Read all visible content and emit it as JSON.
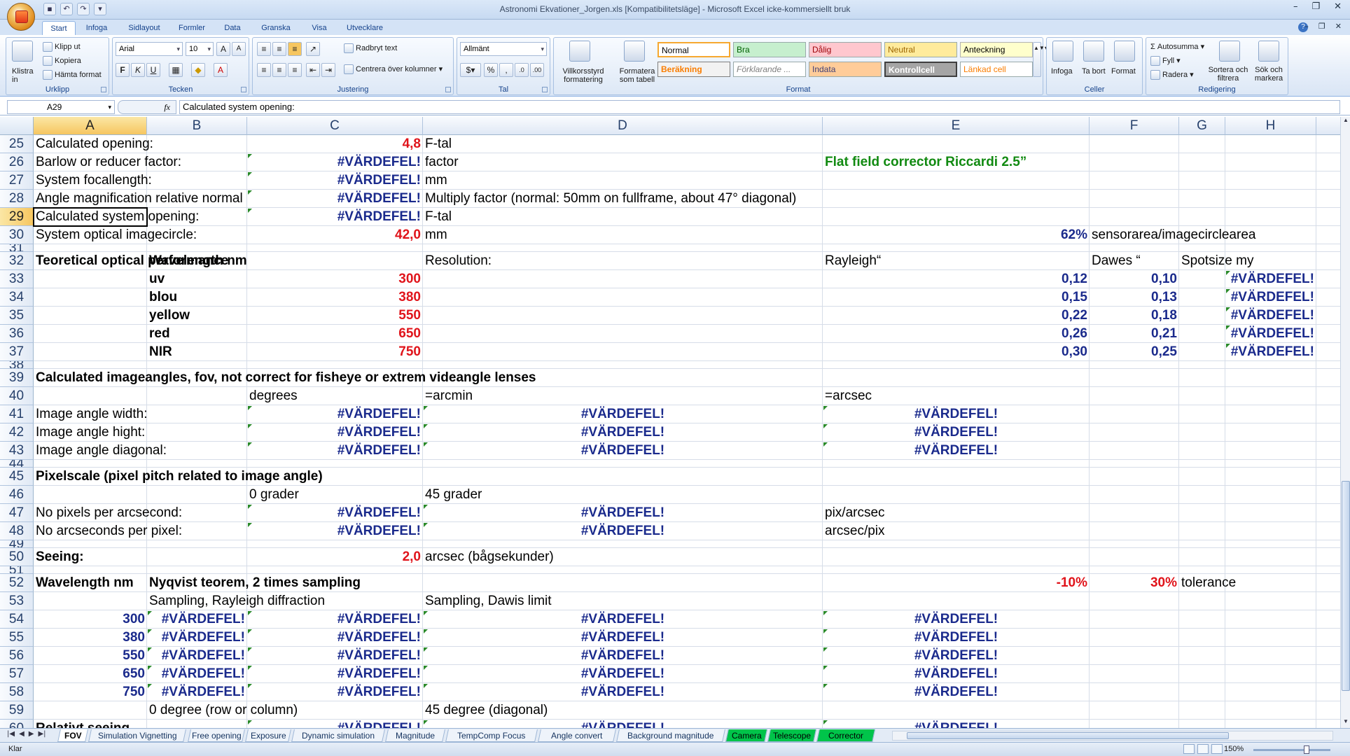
{
  "window": {
    "title": "Astronomi Ekvationer_Jorgen.xls  [Kompatibilitetsläge] - Microsoft Excel icke-kommersiellt bruk"
  },
  "ribbon_tabs": [
    "Start",
    "Infoga",
    "Sidlayout",
    "Formler",
    "Data",
    "Granska",
    "Visa",
    "Utvecklare"
  ],
  "ribbon": {
    "clipboard": {
      "paste": "Klistra\nin",
      "cut": "Klipp ut",
      "copy": "Kopiera",
      "format_painter": "Hämta format",
      "label": "Urklipp"
    },
    "font": {
      "name": "Arial",
      "size": "10",
      "label": "Tecken"
    },
    "alignment": {
      "wrap": "Radbryt text",
      "merge": "Centrera över kolumner",
      "label": "Justering"
    },
    "number": {
      "format": "Allmänt",
      "label": "Tal"
    },
    "styles": {
      "cond_format": "Villkorsstyrd formatering",
      "format_table": "Formatera som tabell",
      "cells": [
        "Normal",
        "Bra",
        "Dålig",
        "Neutral",
        "Anteckning",
        "Beräkning",
        "Förklarande ...",
        "Indata",
        "Kontrollcell",
        "Länkad cell"
      ],
      "label": "Format"
    },
    "cells_group": {
      "insert": "Infoga",
      "delete": "Ta bort",
      "format": "Format",
      "label": "Celler"
    },
    "editing": {
      "autosum": "Autosumma",
      "fill": "Fyll",
      "clear": "Radera",
      "sort": "Sortera och filtrera",
      "find": "Sök och markera",
      "label": "Redigering"
    }
  },
  "formula_bar": {
    "name_box": "A29",
    "fx": "fx",
    "content": "Calculated system opening:"
  },
  "columns": [
    "A",
    "B",
    "C",
    "D",
    "E",
    "F",
    "G",
    "H"
  ],
  "rows": [
    {
      "n": "25",
      "cells": {
        "A": "Calculated opening:",
        "C": "4,8",
        "D": "F-tal"
      }
    },
    {
      "n": "26",
      "cells": {
        "A": "Barlow or reducer factor:",
        "C": "#VÄRDEFEL!",
        "D": "factor",
        "E": "Flat field corrector Riccardi 2.5”"
      }
    },
    {
      "n": "27",
      "cells": {
        "A": "System focallength:",
        "C": "#VÄRDEFEL!",
        "D": "mm"
      }
    },
    {
      "n": "28",
      "cells": {
        "A": "Angle magnification relative normal",
        "C": "#VÄRDEFEL!",
        "D": "Multiply factor (normal: 50mm on fullframe, about 47° diagonal)"
      }
    },
    {
      "n": "29",
      "cells": {
        "A": "Calculated system opening:",
        "C": "#VÄRDEFEL!",
        "D": "F-tal"
      }
    },
    {
      "n": "30",
      "cells": {
        "A": "System optical imagecircle:",
        "C": "42,0",
        "D": "mm",
        "E": "62%",
        "F": "sensorarea/imagecirclearea"
      }
    },
    {
      "n": "31",
      "cells": {}
    },
    {
      "n": "32",
      "cells": {
        "A": "Teoretical optical performance",
        "B": "Wavelength nm",
        "D": "Resolution:",
        "E": "Rayleigh“",
        "F": "Dawes “",
        "G": "Spotsize my"
      }
    },
    {
      "n": "33",
      "cells": {
        "B": "uv",
        "C": "300",
        "E": "0,12",
        "F": "0,10",
        "H": "#VÄRDEFEL!"
      }
    },
    {
      "n": "34",
      "cells": {
        "B": "blou",
        "C": "380",
        "E": "0,15",
        "F": "0,13",
        "H": "#VÄRDEFEL!"
      }
    },
    {
      "n": "35",
      "cells": {
        "B": "yellow",
        "C": "550",
        "E": "0,22",
        "F": "0,18",
        "H": "#VÄRDEFEL!"
      }
    },
    {
      "n": "36",
      "cells": {
        "B": "red",
        "C": "650",
        "E": "0,26",
        "F": "0,21",
        "H": "#VÄRDEFEL!"
      }
    },
    {
      "n": "37",
      "cells": {
        "B": "NIR",
        "C": "750",
        "E": "0,30",
        "F": "0,25",
        "H": "#VÄRDEFEL!"
      }
    },
    {
      "n": "38",
      "cells": {}
    },
    {
      "n": "39",
      "cells": {
        "A": "Calculated imageangles, fov, not correct for fisheye or extrem videangle lenses"
      }
    },
    {
      "n": "40",
      "cells": {
        "C": "degrees",
        "D": "=arcmin",
        "E": "=arcsec"
      }
    },
    {
      "n": "41",
      "cells": {
        "A": "Image angle width:",
        "C": "#VÄRDEFEL!",
        "D": "#VÄRDEFEL!",
        "E": "#VÄRDEFEL!"
      }
    },
    {
      "n": "42",
      "cells": {
        "A": "Image angle hight:",
        "C": "#VÄRDEFEL!",
        "D": "#VÄRDEFEL!",
        "E": "#VÄRDEFEL!"
      }
    },
    {
      "n": "43",
      "cells": {
        "A": "Image angle diagonal:",
        "C": "#VÄRDEFEL!",
        "D": "#VÄRDEFEL!",
        "E": "#VÄRDEFEL!"
      }
    },
    {
      "n": "44",
      "cells": {}
    },
    {
      "n": "45",
      "cells": {
        "A": "Pixelscale (pixel pitch related to image angle)"
      }
    },
    {
      "n": "46",
      "cells": {
        "C": "0 grader",
        "D": "45 grader"
      }
    },
    {
      "n": "47",
      "cells": {
        "A": "No pixels per arcsecond:",
        "C": "#VÄRDEFEL!",
        "D": "#VÄRDEFEL!",
        "E": "pix/arcsec"
      }
    },
    {
      "n": "48",
      "cells": {
        "A": "No arcseconds per pixel:",
        "C": "#VÄRDEFEL!",
        "D": "#VÄRDEFEL!",
        "E": "arcsec/pix"
      }
    },
    {
      "n": "49",
      "cells": {}
    },
    {
      "n": "50",
      "cells": {
        "A": "Seeing:",
        "C": "2,0",
        "D": "arcsec (bågsekunder)"
      }
    },
    {
      "n": "51",
      "cells": {}
    },
    {
      "n": "52",
      "cells": {
        "A": "Wavelength nm",
        "B": "Nyqvist teorem, 2 times sampling",
        "E": "-10%",
        "F": "30%",
        "G": "tolerance"
      }
    },
    {
      "n": "53",
      "cells": {
        "B": "Sampling, Rayleigh diffraction",
        "D": "Sampling, Dawis limit"
      }
    },
    {
      "n": "54",
      "cells": {
        "A": "300",
        "B": "#VÄRDEFEL!",
        "C": "#VÄRDEFEL!",
        "D": "#VÄRDEFEL!",
        "E": "#VÄRDEFEL!"
      }
    },
    {
      "n": "55",
      "cells": {
        "A": "380",
        "B": "#VÄRDEFEL!",
        "C": "#VÄRDEFEL!",
        "D": "#VÄRDEFEL!",
        "E": "#VÄRDEFEL!"
      }
    },
    {
      "n": "56",
      "cells": {
        "A": "550",
        "B": "#VÄRDEFEL!",
        "C": "#VÄRDEFEL!",
        "D": "#VÄRDEFEL!",
        "E": "#VÄRDEFEL!"
      }
    },
    {
      "n": "57",
      "cells": {
        "A": "650",
        "B": "#VÄRDEFEL!",
        "C": "#VÄRDEFEL!",
        "D": "#VÄRDEFEL!",
        "E": "#VÄRDEFEL!"
      }
    },
    {
      "n": "58",
      "cells": {
        "A": "750",
        "B": "#VÄRDEFEL!",
        "C": "#VÄRDEFEL!",
        "D": "#VÄRDEFEL!",
        "E": "#VÄRDEFEL!"
      }
    },
    {
      "n": "59",
      "cells": {
        "B": "0 degree (row or column)",
        "D": "45 degree (diagonal)"
      }
    },
    {
      "n": "60",
      "cells": {
        "A": "Relativt seeing",
        "C": "#VÄRDEFEL!",
        "D": "#VÄRDEFEL!",
        "E": "#VÄRDEFEL!"
      }
    }
  ],
  "sheet_tabs": [
    "FOV",
    "Simulation Vignetting",
    "Free opening",
    "Exposure",
    "Dynamic simulation",
    "Magnitude",
    "TempComp Focus",
    "Angle convert",
    "Background magnitude",
    "Camera",
    "Telescope",
    "Corrector"
  ],
  "active_sheet": "FOV",
  "status": {
    "mode": "Klar",
    "zoom": "150%"
  },
  "colors": {
    "error_navy": "#1a2a8c",
    "input_red": "#e0141b",
    "note_green": "#118a11",
    "sheet_tab_green": "#00c44a"
  }
}
